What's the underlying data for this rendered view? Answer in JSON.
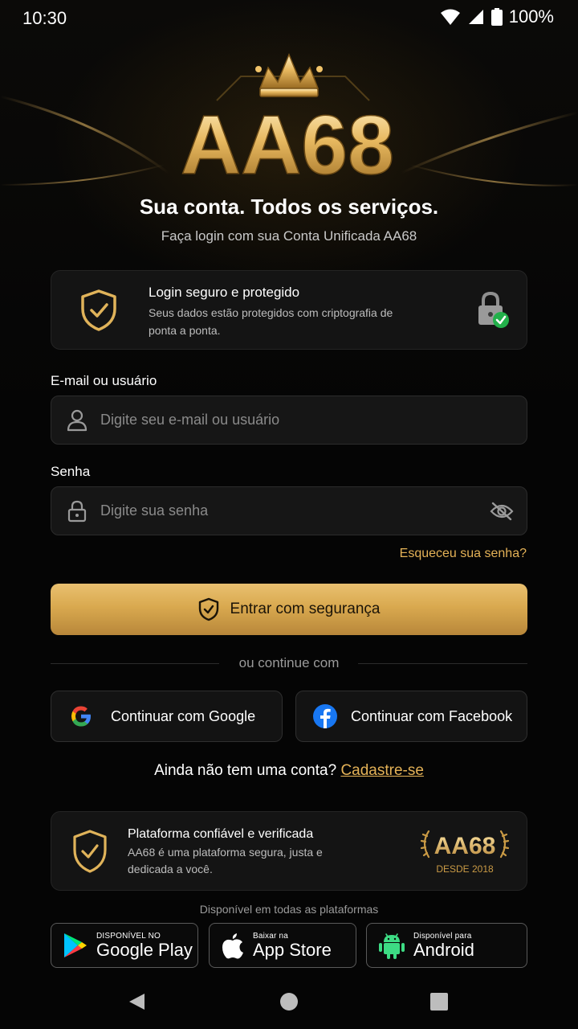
{
  "status_bar": {
    "time": "10:30",
    "battery": "100%"
  },
  "brand": {
    "logo_text": "AA68",
    "gold": "#e0b35a",
    "gold_dark": "#b8873a"
  },
  "header": {
    "headline": "Sua conta. Todos os serviços.",
    "subheadline": "Faça login com sua Conta Unificada AA68"
  },
  "secure_card": {
    "title": "Login seguro e protegido",
    "description": "Seus dados estão protegidos com criptografia de ponta a ponta.",
    "icon": "shield-check-icon",
    "status_icon": "lock-verified-icon"
  },
  "form": {
    "email_label": "E-mail ou usuário",
    "email_placeholder": "Digite seu e-mail ou usuário",
    "email_value": "",
    "password_label": "Senha",
    "password_placeholder": "Digite sua senha",
    "password_value": "",
    "forgot_link": "Esqueceu sua senha?",
    "submit_label": "Entrar com segurança"
  },
  "divider": {
    "text": "ou continue com"
  },
  "social": {
    "google_label": "Continuar com Google",
    "facebook_label": "Continuar com Facebook"
  },
  "signup": {
    "prompt": "Ainda não tem uma conta?",
    "link": "Cadastre-se"
  },
  "trust_card": {
    "title": "Plataforma confiável e verificada",
    "description": "AA68 é uma plataforma segura, justa e dedicada a você.",
    "badge_name": "AA68",
    "badge_since": "DESDE 2018"
  },
  "platforms": {
    "caption": "Disponível em todas as plataformas",
    "google_play": {
      "small": "DISPONÍVEL NO",
      "big": "Google Play"
    },
    "app_store": {
      "small": "Baixar na",
      "big": "App Store"
    },
    "android": {
      "small": "Disponível para",
      "big": "Android"
    }
  }
}
